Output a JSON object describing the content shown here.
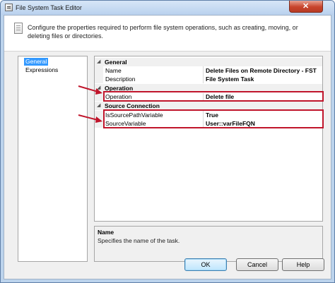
{
  "window": {
    "title": "File System Task Editor"
  },
  "header": {
    "description": "Configure the properties required to perform file system operations, such as creating, moving, or deleting files or directories."
  },
  "nav": {
    "items": [
      "General",
      "Expressions"
    ],
    "selected": "General"
  },
  "properties": {
    "categories": {
      "general": "General",
      "operation": "Operation",
      "source_connection": "Source Connection"
    },
    "rows": {
      "name": {
        "label": "Name",
        "value": "Delete Files on Remote Directory - FST"
      },
      "description": {
        "label": "Description",
        "value": "File System Task"
      },
      "operation": {
        "label": "Operation",
        "value": "Delete file"
      },
      "is_source_path_variable": {
        "label": "IsSourcePathVariable",
        "value": "True"
      },
      "source_variable": {
        "label": "SourceVariable",
        "value": "User::varFileFQN"
      }
    }
  },
  "description_panel": {
    "title": "Name",
    "text": "Specifies the name of the task."
  },
  "buttons": {
    "ok": "OK",
    "cancel": "Cancel",
    "help": "Help"
  },
  "colors": {
    "highlight": "#c0152b",
    "selection": "#3399ff",
    "close": "#c8442c"
  },
  "icons": {
    "app": "dialog-icon",
    "info": "document-icon",
    "close": "close-icon",
    "collapse": "collapse-icon"
  }
}
